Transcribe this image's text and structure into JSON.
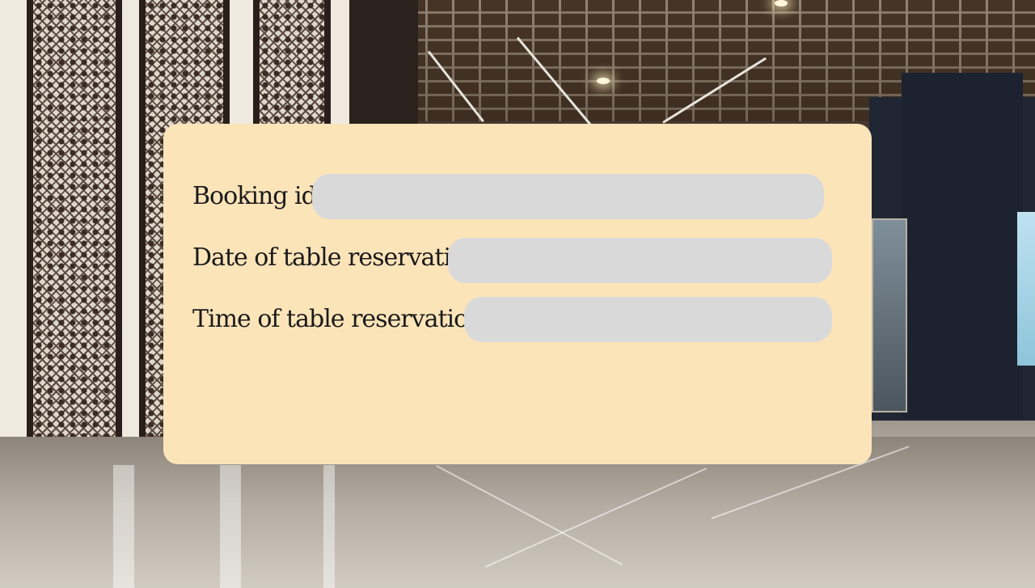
{
  "form": {
    "fields": [
      {
        "label": "Booking id:",
        "value": "",
        "placeholder": ""
      },
      {
        "label": "Date of table reservation:",
        "value": "",
        "placeholder": ""
      },
      {
        "label": "Time of table reservation:",
        "value": "",
        "placeholder": ""
      }
    ]
  },
  "colors": {
    "card_background": "#fce4b9",
    "field_background": "#d9d9d9",
    "label_text": "#1a1a1a"
  }
}
